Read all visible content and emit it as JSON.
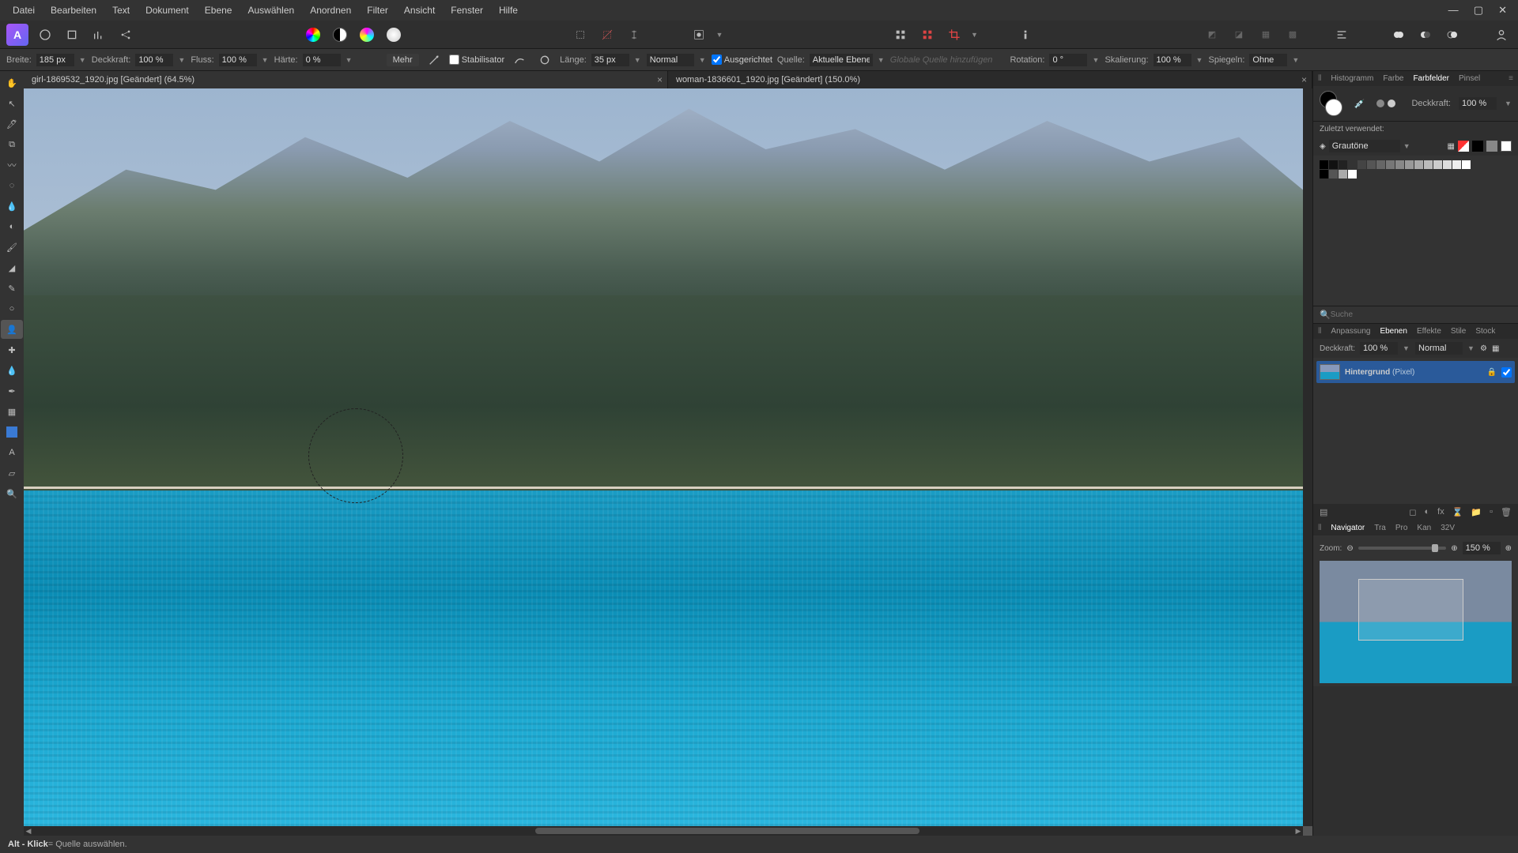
{
  "menu": [
    "Datei",
    "Bearbeiten",
    "Text",
    "Dokument",
    "Ebene",
    "Auswählen",
    "Anordnen",
    "Filter",
    "Ansicht",
    "Fenster",
    "Hilfe"
  ],
  "context": {
    "width_label": "Breite:",
    "width_val": "185 px",
    "opacity_label": "Deckkraft:",
    "opacity_val": "100 %",
    "flow_label": "Fluss:",
    "flow_val": "100 %",
    "hardness_label": "Härte:",
    "hardness_val": "0 %",
    "more": "Mehr",
    "stabilizer": "Stabilisator",
    "length_label": "Länge:",
    "length_val": "35 px",
    "blend": "Normal",
    "aligned": "Ausgerichtet",
    "source_label": "Quelle:",
    "source_val": "Aktuelle Ebene",
    "global_disabled": "Globale Quelle hinzufügen",
    "rotation_label": "Rotation:",
    "rotation_val": "0 °",
    "scale_label": "Skalierung:",
    "scale_val": "100 %",
    "mirror_label": "Spiegeln:",
    "mirror_val": "Ohne"
  },
  "tabs": [
    {
      "label": "girl-1869532_1920.jpg [Geändert] (64.5%)",
      "active": true
    },
    {
      "label": "woman-1836601_1920.jpg [Geändert] (150.0%)",
      "active": false
    }
  ],
  "right": {
    "top_tabs": [
      "Histogramm",
      "Farbe",
      "Farbfelder",
      "Pinsel"
    ],
    "top_active": "Farbfelder",
    "opacity_label": "Deckkraft:",
    "opacity_val": "100 %",
    "recent": "Zuletzt verwendet:",
    "palette": "Grautöne",
    "search_ph": "Suche",
    "mid_tabs": [
      "Anpassung",
      "Ebenen",
      "Effekte",
      "Stile",
      "Stock"
    ],
    "mid_active": "Ebenen",
    "layer_opacity_label": "Deckkraft:",
    "layer_opacity_val": "100 %",
    "layer_blend": "Normal",
    "layer_name": "Hintergrund",
    "layer_type": "(Pixel)",
    "nav_tabs": [
      "Navigator",
      "Tra",
      "Pro",
      "Kan",
      "32V"
    ],
    "nav_active": "Navigator",
    "zoom_label": "Zoom:",
    "zoom_val": "150 %"
  },
  "status": {
    "key": "Alt - Klick",
    "desc": " = Quelle auswählen."
  }
}
